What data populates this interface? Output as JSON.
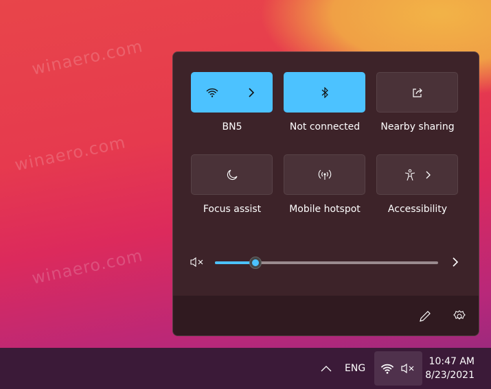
{
  "watermark": "winaero.com",
  "quick_settings": {
    "tiles": [
      {
        "label": "BN5",
        "icon": "wifi-icon",
        "active": true,
        "has_chevron": true
      },
      {
        "label": "Not connected",
        "icon": "bluetooth-icon",
        "active": true,
        "has_chevron": false
      },
      {
        "label": "Nearby sharing",
        "icon": "share-icon",
        "active": false,
        "has_chevron": false
      },
      {
        "label": "Focus assist",
        "icon": "moon-icon",
        "active": false,
        "has_chevron": false
      },
      {
        "label": "Mobile hotspot",
        "icon": "hotspot-icon",
        "active": false,
        "has_chevron": false
      },
      {
        "label": "Accessibility",
        "icon": "accessibility-icon",
        "active": false,
        "has_chevron": true
      }
    ],
    "volume": {
      "muted": true,
      "level_percent": 18
    },
    "accent": "#4cc2ff"
  },
  "taskbar": {
    "language": "ENG",
    "time": "10:47 AM",
    "date": "8/23/2021"
  }
}
